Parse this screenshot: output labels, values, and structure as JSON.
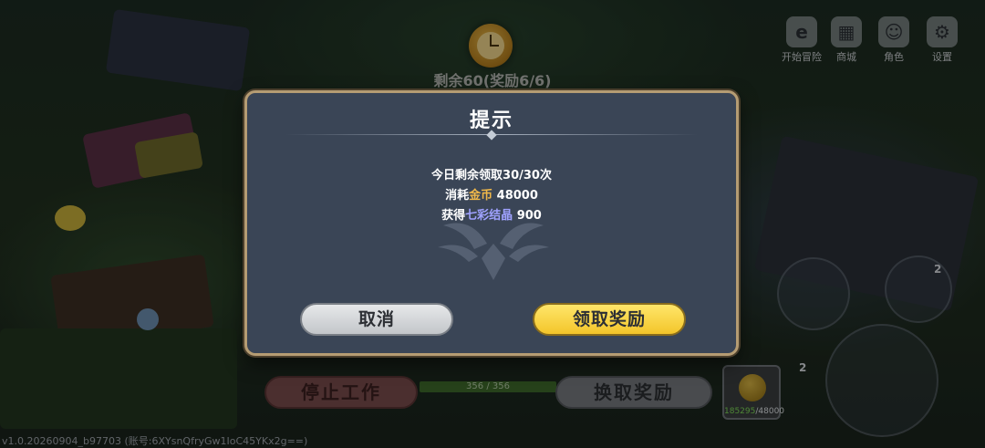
{
  "hud": {
    "remaining": "剩余60(奖励6/6)",
    "top_buttons": [
      {
        "label": "开始冒险",
        "icon": "adventure-icon"
      },
      {
        "label": "商城",
        "icon": "shop-icon"
      },
      {
        "label": "角色",
        "icon": "character-icon"
      },
      {
        "label": "设置",
        "icon": "gear-icon"
      }
    ],
    "stop_work": "停止工作",
    "progress_text": "356 / 356",
    "exchange": "换取奖励",
    "coin_have": "185295",
    "coin_need": "/48000",
    "badge_count": "2",
    "skill_badge": "2"
  },
  "dialog": {
    "title": "提示",
    "line1": "今日剩余领取30/30次",
    "line2_prefix": "消耗",
    "line2_item": "金币",
    "line2_amount": " 48000",
    "line3_prefix": "获得",
    "line3_item": "七彩结晶",
    "line3_amount": " 900",
    "cancel_label": "取消",
    "confirm_label": "领取奖励"
  },
  "footer": {
    "version": "v1.0.20260904_b97703 (账号:6XYsnQfryGw1IoC45YKx2g==)"
  },
  "colors": {
    "gold_text": "#f0b84a",
    "purple_text": "#9fa2ff",
    "confirm_button": "#f3c52a",
    "cancel_button": "#c3c6ca",
    "dialog_bg": "#3a4556",
    "dialog_border": "#b59c73"
  }
}
